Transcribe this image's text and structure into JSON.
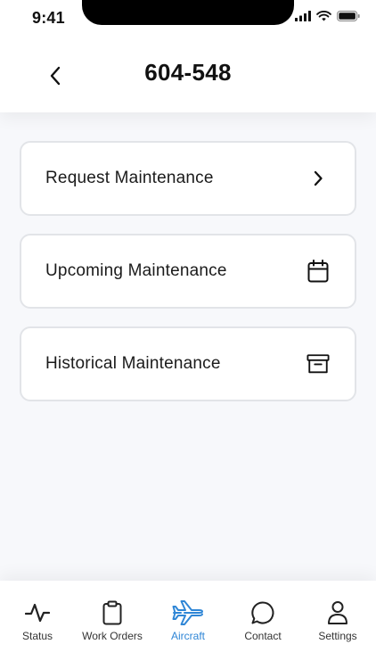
{
  "status_bar": {
    "time": "9:41"
  },
  "header": {
    "title": "604-548"
  },
  "menu": {
    "items": [
      {
        "label": "Request Maintenance",
        "icon": "chevron-right-icon"
      },
      {
        "label": "Upcoming Maintenance",
        "icon": "calendar-icon"
      },
      {
        "label": "Historical Maintenance",
        "icon": "archive-box-icon"
      }
    ]
  },
  "tabs": [
    {
      "label": "Status",
      "icon": "activity-icon"
    },
    {
      "label": "Work Orders",
      "icon": "clipboard-icon"
    },
    {
      "label": "Aircraft",
      "icon": "airplane-icon",
      "active": true
    },
    {
      "label": "Contact",
      "icon": "chat-bubble-icon"
    },
    {
      "label": "Settings",
      "icon": "user-icon"
    }
  ],
  "colors": {
    "accent": "#2f86d6",
    "background": "#f7f8fb",
    "card_border": "#e2e4e8"
  }
}
